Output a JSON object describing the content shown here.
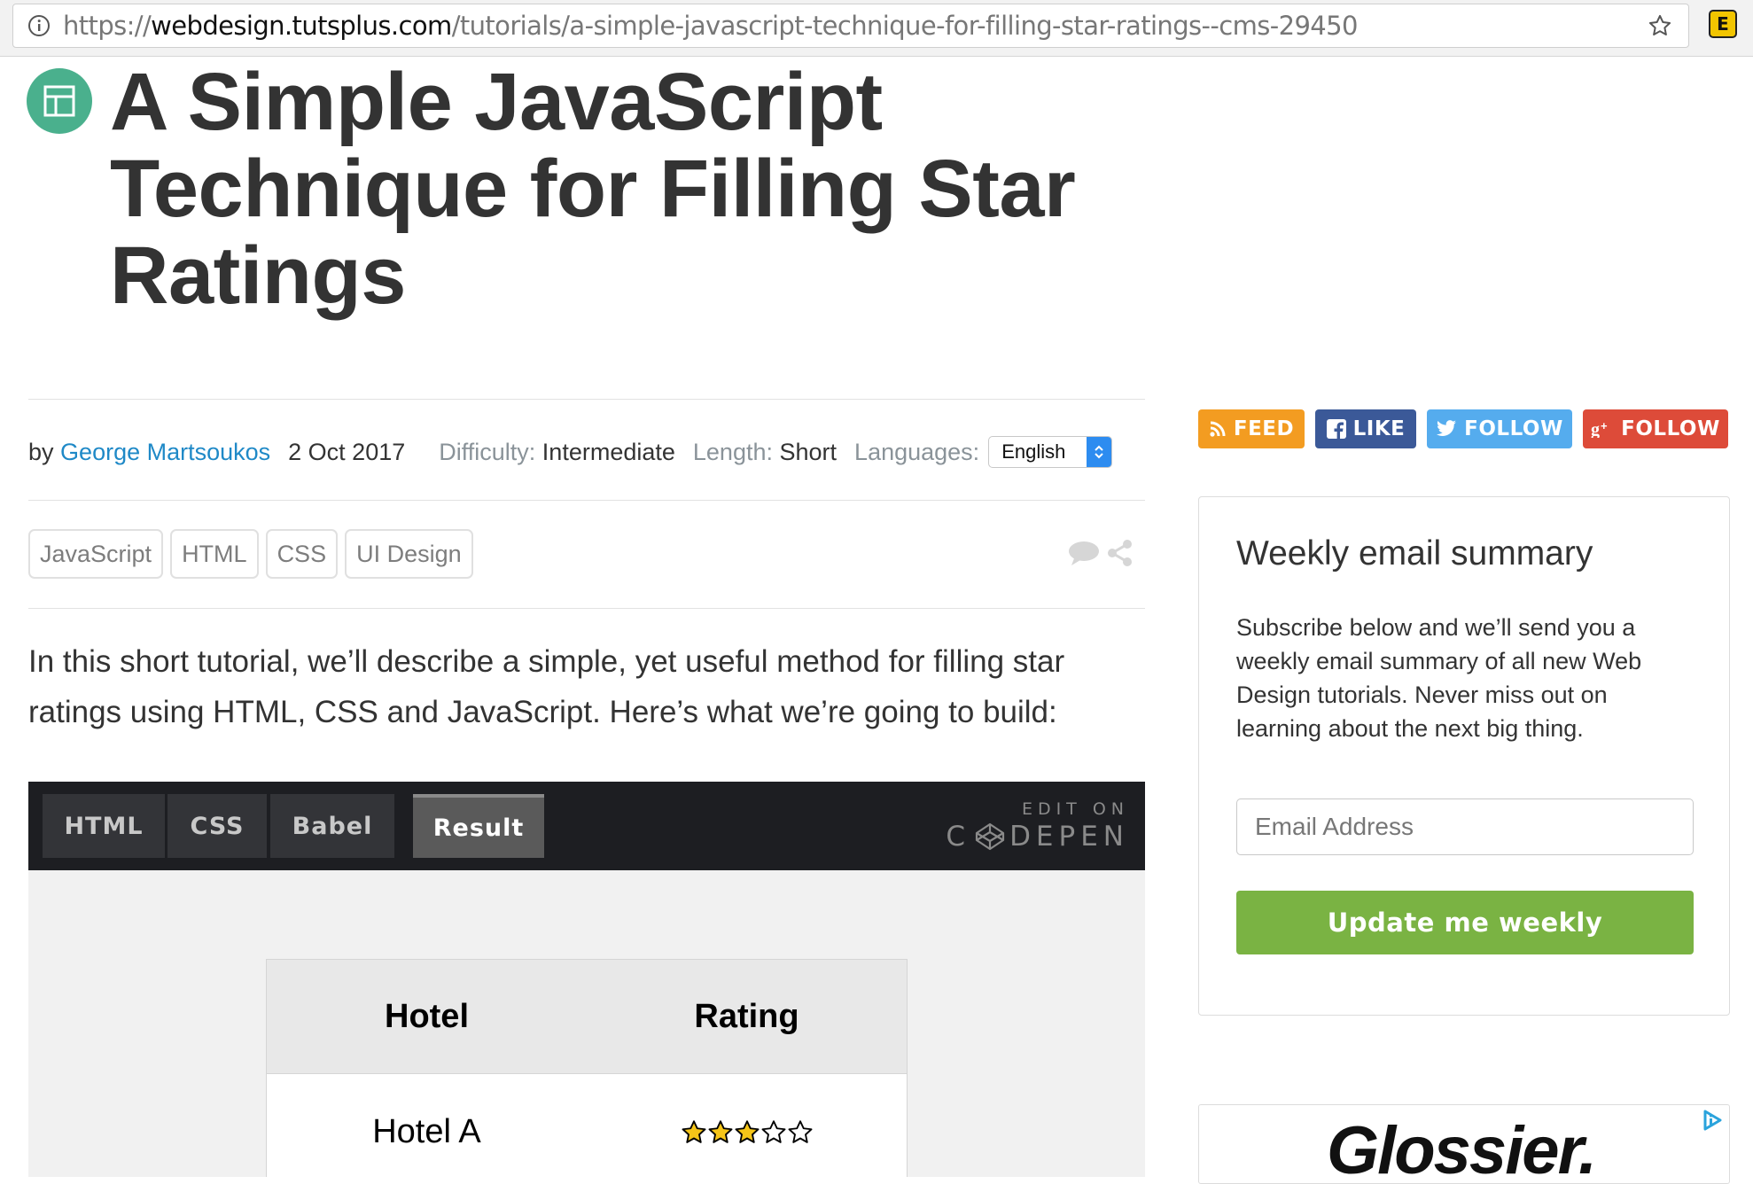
{
  "browser": {
    "url_scheme": "https://",
    "url_host": "webdesign.tutsplus.com",
    "url_path": "/tutorials/a-simple-javascript-technique-for-filling-star-ratings--cms-29450",
    "extension_label": "E"
  },
  "article": {
    "category_icon": "layout-icon",
    "title": "A Simple JavaScript Technique for Filling Star Ratings",
    "by_label": "by",
    "author": "George Martsoukos",
    "date": "2 Oct 2017",
    "difficulty_label": "Difficulty:",
    "difficulty": "Intermediate",
    "length_label": "Length:",
    "length": "Short",
    "languages_label": "Languages:",
    "language_selected": "English",
    "tags": [
      "JavaScript",
      "HTML",
      "CSS",
      "UI Design"
    ],
    "intro": "In this short tutorial, we’ll describe a simple, yet useful method for filling star ratings using HTML, CSS and JavaScript. Here’s what we’re going to build:"
  },
  "codepen": {
    "tabs": [
      "HTML",
      "CSS",
      "Babel",
      "Result"
    ],
    "active_tab": "Result",
    "edit_on": "EDIT ON",
    "brand_left": "C",
    "brand_right": "DEPEN",
    "table": {
      "headers": [
        "Hotel",
        "Rating"
      ],
      "rows": [
        {
          "hotel": "Hotel A",
          "rating": 3,
          "max": 5
        }
      ]
    },
    "star_fill_color": "#f5c518"
  },
  "sidebar": {
    "follow_buttons": [
      {
        "label": "FEED",
        "icon": "rss-icon",
        "color": "#f39c21"
      },
      {
        "label": "LIKE",
        "icon": "facebook-icon",
        "color": "#3b5998"
      },
      {
        "label": "FOLLOW",
        "icon": "twitter-icon",
        "color": "#55acee"
      },
      {
        "label": "FOLLOW",
        "icon": "google-plus-icon",
        "color": "#dd4b39"
      }
    ],
    "summary_title": "Weekly email summary",
    "summary_text": "Subscribe below and we’ll send you a weekly email summary of all new Web Design tutorials. Never miss out on learning about the next big thing.",
    "email_placeholder": "Email Address",
    "submit_label": "Update me weekly",
    "ad_logo": "Glossier."
  }
}
